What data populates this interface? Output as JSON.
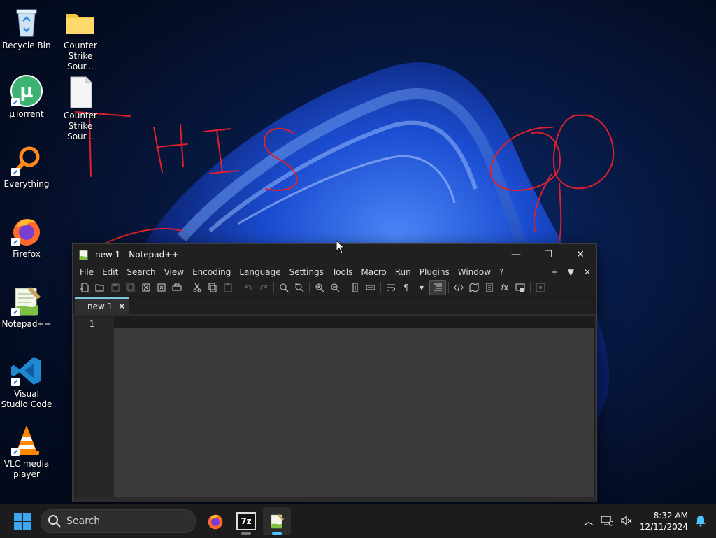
{
  "desktop": {
    "icons": [
      {
        "label": "Recycle Bin",
        "icon": "recycle-bin-icon"
      },
      {
        "label": "Counter Strike Sour...",
        "icon": "folder-icon"
      },
      {
        "label": "µTorrent",
        "icon": "utorrent-icon"
      },
      {
        "label": "Counter Strike Sour...",
        "icon": "blank-file-icon"
      },
      {
        "label": "Everything",
        "icon": "everything-search-icon"
      },
      {
        "label": "Firefox",
        "icon": "firefox-icon"
      },
      {
        "label": "Notepad++",
        "icon": "notepadpp-icon"
      },
      {
        "label": "Visual Studio Code",
        "icon": "vscode-icon"
      },
      {
        "label": "VLC media player",
        "icon": "vlc-icon"
      }
    ],
    "annotation_color": "#e0202a"
  },
  "window": {
    "title": "new 1 - Notepad++",
    "controls": {
      "minimize": "—",
      "maximize": "☐",
      "close": "✕"
    },
    "menu": [
      "File",
      "Edit",
      "Search",
      "View",
      "Encoding",
      "Language",
      "Settings",
      "Tools",
      "Macro",
      "Run",
      "Plugins",
      "Window",
      "?"
    ],
    "menu_right": [
      "+",
      "▼",
      "✕"
    ],
    "tab": {
      "label": "new 1",
      "close": "✕"
    },
    "editor": {
      "line_number": "1"
    },
    "accent": "#7fc8e0"
  },
  "taskbar": {
    "search_placeholder": "Search",
    "apps": [
      "firefox-icon",
      "7zip-icon",
      "notepadpp-icon"
    ],
    "sevenzip_label": "7z",
    "time": "8:32 AM",
    "date": "12/11/2024",
    "accent": "#4cc2ff"
  }
}
